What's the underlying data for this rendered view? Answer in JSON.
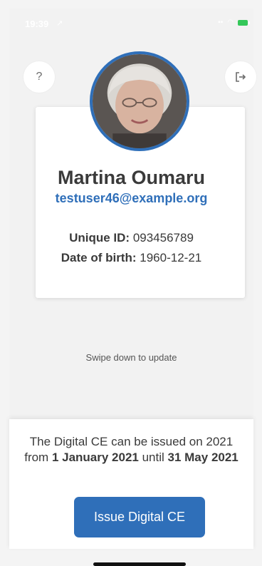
{
  "status_bar": {
    "time": "19:39",
    "location_glyph": "↗",
    "signal_icon": "signal-icon",
    "wifi_icon": "wifi-icon",
    "battery_icon": "battery-icon"
  },
  "header": {
    "help_label": "?",
    "logout_label": "⇥"
  },
  "profile": {
    "name": "Martina Oumaru",
    "email": "testuser46@example.org",
    "unique_id_label": "Unique ID:",
    "unique_id_value": "093456789",
    "dob_label": "Date of birth:",
    "dob_value": "1960-12-21"
  },
  "hint": {
    "swipe": "Swipe down to update"
  },
  "sheet": {
    "text_prefix": "The Digital CE can be issued on 2021 from ",
    "start_date": "1 January 2021",
    "text_mid": " until ",
    "end_date": "31 May 2021",
    "issue_button_label": "Issue Digital CE"
  },
  "colors": {
    "accent": "#2f6fb9",
    "background": "#f2f2f2",
    "battery": "#34c759"
  }
}
